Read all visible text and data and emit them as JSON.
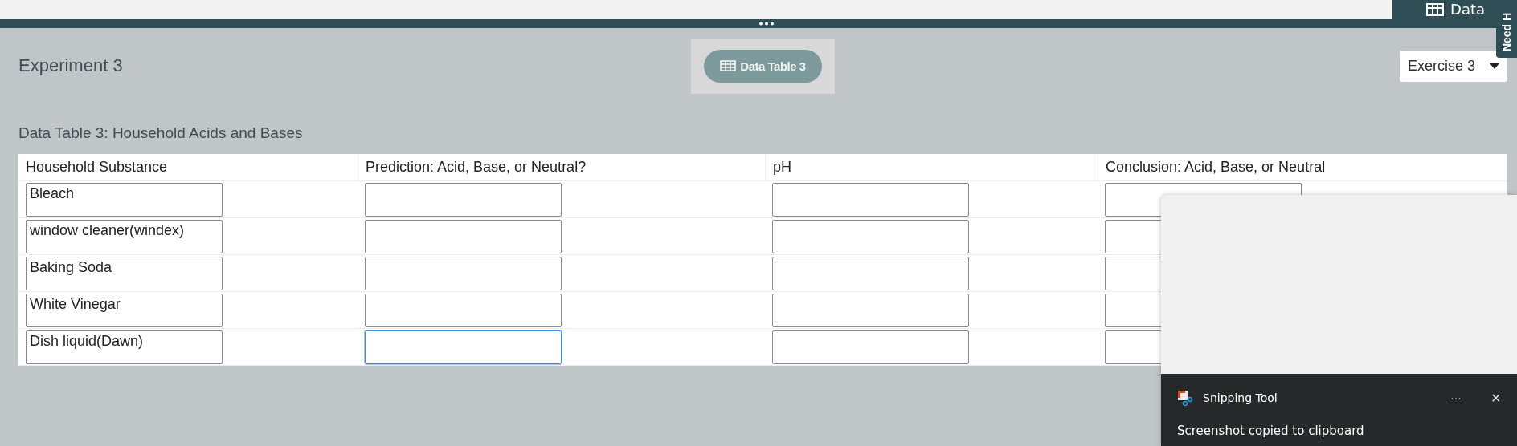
{
  "top_tab": {
    "label": "Data"
  },
  "help_tab": {
    "label": "Need H"
  },
  "header": {
    "title": "Experiment 3",
    "view_button": {
      "label": "Data Table 3"
    },
    "exercise_select": {
      "value": "Exercise 3"
    }
  },
  "table": {
    "title": "Data Table 3: Household Acids and Bases",
    "columns": [
      "Household Substance",
      "Prediction: Acid, Base, or Neutral?",
      "pH",
      "Conclusion: Acid, Base, or Neutral"
    ],
    "rows": [
      {
        "cells": [
          {
            "value": "Bleach",
            "focused": false
          },
          {
            "focused": false
          },
          {
            "focused": false
          },
          {
            "focused": false
          }
        ]
      },
      {
        "cells": [
          {
            "value": "window cleaner(windex)",
            "focused": false
          },
          {
            "focused": false
          },
          {
            "focused": false
          },
          {
            "focused": false
          }
        ]
      },
      {
        "cells": [
          {
            "value": "Baking Soda",
            "focused": false
          },
          {
            "focused": false
          },
          {
            "focused": false
          },
          {
            "focused": false
          }
        ]
      },
      {
        "cells": [
          {
            "value": "White Vinegar",
            "focused": false
          },
          {
            "focused": false
          },
          {
            "focused": false
          },
          {
            "focused": false
          }
        ]
      },
      {
        "cells": [
          {
            "value": "Dish liquid(Dawn)",
            "focused": false
          },
          {
            "focused": true
          },
          {
            "focused": false
          },
          {
            "focused": false
          }
        ]
      }
    ]
  },
  "notification": {
    "app": "Snipping Tool",
    "more": "···",
    "close": "✕",
    "message": "Screenshot copied to clipboard"
  }
}
